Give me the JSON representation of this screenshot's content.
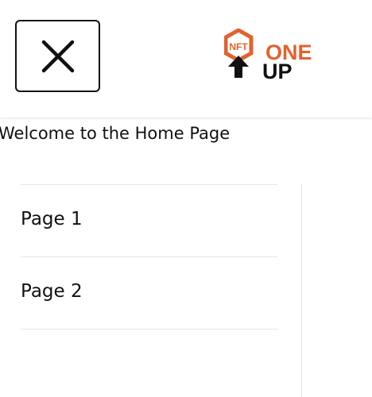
{
  "header": {
    "close_icon": "close-icon",
    "logo": {
      "badge_text": "NFT",
      "word_one": "ONE",
      "word_up": "UP",
      "brand_color": "#E2622F",
      "dark_color": "#111111"
    }
  },
  "main": {
    "welcome_text": "Welcome to the Home Page"
  },
  "menu": {
    "items": [
      {
        "label": "Page 1"
      },
      {
        "label": "Page 2"
      }
    ]
  }
}
